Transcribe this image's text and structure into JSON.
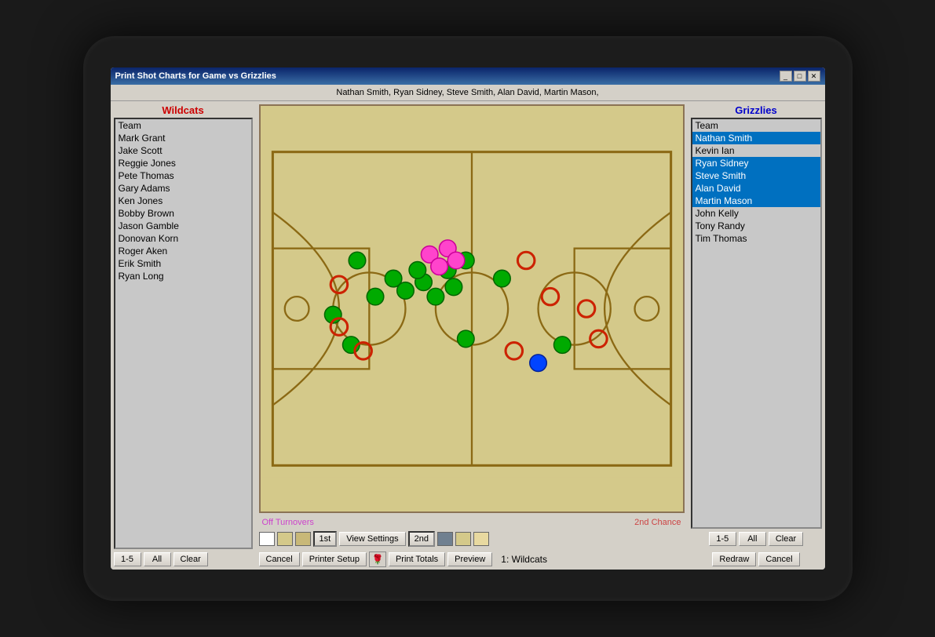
{
  "window": {
    "title": "Print Shot Charts for Game vs Grizzlies",
    "selected_players": "Nathan Smith, Ryan Sidney, Steve Smith, Alan David, Martin Mason,"
  },
  "wildcats": {
    "header": "Wildcats",
    "players": [
      {
        "name": "Team",
        "selected": false
      },
      {
        "name": "Mark Grant",
        "selected": false
      },
      {
        "name": "Jake Scott",
        "selected": false
      },
      {
        "name": "Reggie Jones",
        "selected": false
      },
      {
        "name": "Pete Thomas",
        "selected": false
      },
      {
        "name": "Gary Adams",
        "selected": false
      },
      {
        "name": "Ken Jones",
        "selected": false
      },
      {
        "name": "Bobby Brown",
        "selected": false
      },
      {
        "name": "Jason Gamble",
        "selected": false
      },
      {
        "name": "Donovan Korn",
        "selected": false
      },
      {
        "name": "Roger Aken",
        "selected": false
      },
      {
        "name": "Erik Smith",
        "selected": false
      },
      {
        "name": "Ryan Long",
        "selected": false
      }
    ],
    "buttons": {
      "range": "1-5",
      "all": "All",
      "clear": "Clear"
    }
  },
  "grizzlies": {
    "header": "Grizzlies",
    "players": [
      {
        "name": "Team",
        "selected": false
      },
      {
        "name": "Nathan Smith",
        "selected": true
      },
      {
        "name": "Kevin Ian",
        "selected": false
      },
      {
        "name": "Ryan Sidney",
        "selected": true
      },
      {
        "name": "Steve Smith",
        "selected": true
      },
      {
        "name": "Alan David",
        "selected": true
      },
      {
        "name": "Martin Mason",
        "selected": true
      },
      {
        "name": "John Kelly",
        "selected": false
      },
      {
        "name": "Tony Randy",
        "selected": false
      },
      {
        "name": "Tim Thomas",
        "selected": false
      }
    ],
    "buttons": {
      "range": "1-5",
      "all": "All",
      "clear": "Clear"
    }
  },
  "court": {
    "off_turnovers": "Off Turnovers",
    "second_chance": "2nd Chance"
  },
  "controls": {
    "period_1st": "1st",
    "view_settings": "View Settings",
    "period_2nd": "2nd",
    "cancel": "Cancel",
    "printer_setup": "Printer Setup",
    "print_totals": "Print Totals",
    "preview": "Preview",
    "status": "1: Wildcats",
    "redraw": "Redraw",
    "cancel_right": "Cancel"
  },
  "titlebar_buttons": {
    "minimize": "_",
    "maximize": "□",
    "close": "✕"
  }
}
